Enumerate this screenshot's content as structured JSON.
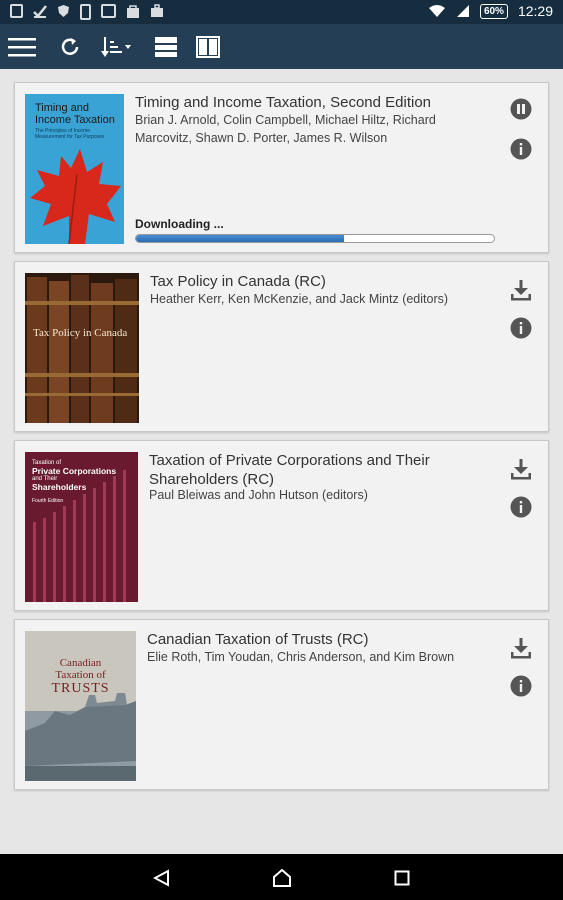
{
  "status_bar": {
    "battery": "60%",
    "time": "12:29",
    "left_icons": [
      "gallery-icon",
      "check-icon",
      "shield-icon",
      "phone-icon",
      "news-icon",
      "bag-icon",
      "briefcase-icon"
    ]
  },
  "app_bar": {
    "icons": [
      "menu-icon",
      "refresh-icon",
      "sort-icon",
      "list-view-icon",
      "grid-view-icon"
    ]
  },
  "books": [
    {
      "title": "Timing and Income Taxation, Second Edition",
      "authors": "Brian J. Arnold, Colin Campbell, Michael Hiltz, Richard Marcovitz, Shawn D. Porter, James R. Wilson",
      "action": "pause",
      "download_status": "Downloading ...",
      "progress": 0.58,
      "cover": {
        "title": "Timing and Income Taxation",
        "subtitle": "The Principles of Income Measurement for Tax Purposes",
        "bg": "#3aa3d6"
      }
    },
    {
      "title": "Tax Policy in Canada (RC)",
      "authors": "Heather Kerr, Ken McKenzie, and Jack Mintz (editors)",
      "action": "download",
      "cover": {
        "title": "Tax Policy in Canada",
        "bg": "#3d2414"
      }
    },
    {
      "title": "Taxation of Private Corporations and Their Shareholders (RC)",
      "authors": "Paul Bleiwas and John Hutson (editors)",
      "action": "download",
      "cover": {
        "title_line1": "Taxation of",
        "title_line2": "Private Corporations",
        "title_line3": "and Their",
        "title_line4": "Shareholders",
        "edition": "Fourth Edition",
        "bg": "#6a1a2e"
      }
    },
    {
      "title": "Canadian Taxation of Trusts (RC)",
      "authors": "Elie Roth, Tim Youdan, Chris Anderson, and Kim Brown",
      "action": "download",
      "cover": {
        "title_line1": "Canadian",
        "title_line2": "Taxation of",
        "title_line3": "TRUSTS",
        "bg": "#c8c4ba"
      }
    }
  ],
  "nav_bar": {
    "icons": [
      "back-icon",
      "home-icon",
      "recents-icon"
    ]
  },
  "colors": {
    "status_bar": "#152d3f",
    "app_bar": "#243e55",
    "background": "#e6e6e6",
    "progress": "#2a6cb3"
  }
}
